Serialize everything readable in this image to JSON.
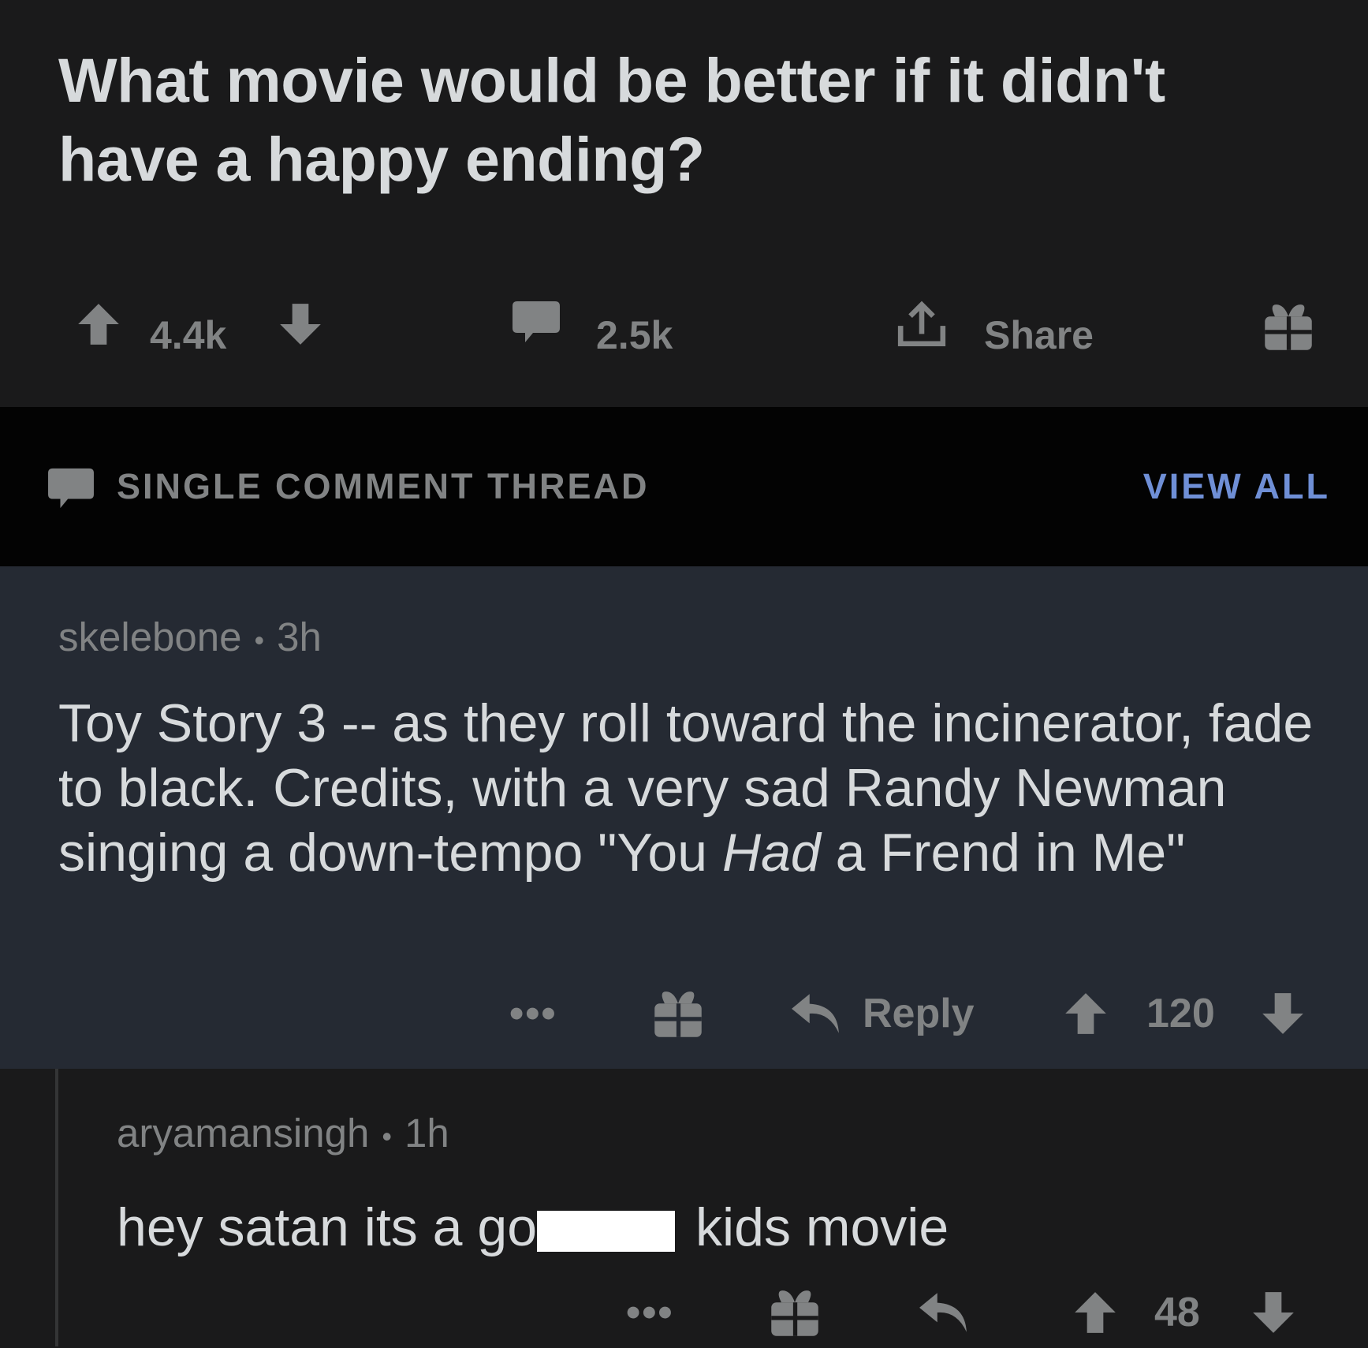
{
  "post": {
    "title": "What movie would be better if it didn't have a happy ending?",
    "vote_count": "4.4k",
    "comment_count": "2.5k",
    "share_label": "Share"
  },
  "thread_bar": {
    "label": "SINGLE COMMENT THREAD",
    "view_all_label": "VIEW ALL"
  },
  "comments": [
    {
      "author": "skelebone",
      "separator": "•",
      "age": "3h",
      "body_part1": "Toy Story 3 -- as they roll toward the incinerator, fade to black. Credits, with a very sad Randy Newman singing a down-tempo \"You ",
      "body_italic": "Had",
      "body_part2": " a Frend in Me\"",
      "more_label": "•••",
      "reply_label": "Reply",
      "score": "120"
    },
    {
      "author": "aryamansingh",
      "separator": "•",
      "age": "1h",
      "body_before_redaction": "hey satan its a go",
      "body_after_redaction": "kids movie",
      "more_label": "•••",
      "score": "48"
    }
  ],
  "icons": {
    "upvote": "arrow-up-icon",
    "downvote": "arrow-down-icon",
    "comment": "speech-bubble-icon",
    "share": "share-icon",
    "award": "gift-icon",
    "reply": "reply-arrow-icon"
  },
  "colors": {
    "post_background": "#1a1a1b",
    "thread_bar_background": "#030303",
    "highlighted_comment_background": "#252a33",
    "text_primary": "#d7dadc",
    "text_secondary": "#818384",
    "link_blue": "#6f8fd6"
  }
}
